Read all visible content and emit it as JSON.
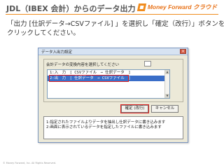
{
  "slide": {
    "title": "JDL（IBEX 会計）からのデータ出力",
    "logo_text": "Money Forward クラウド",
    "instruction_line1": "「出力 [仕訳データ→CSVファイル] 」を選択し「確定（改行）」ボタンを",
    "instruction_line2": "クリックしてください。",
    "copyright": "© Money Forward, Inc. All Rights Reserved."
  },
  "dialog": {
    "title": "データ入出力設定",
    "close_glyph": "×",
    "prompt": "会計データの変換内容を選択してください",
    "options": [
      {
        "label": "1:入　力　[ CSVファイル　→ 仕訳データ　]",
        "selected": false
      },
      {
        "label": "2:出　力　[ 仕訳データ　→ CSVファイル　]",
        "selected": true
      }
    ],
    "confirm_label": "確定 (改行)",
    "cancel_label": "キャンセル",
    "messages": [
      "1:指定されたファイルよりデータを抽出し仕訳データに書き込みます",
      "2:画面に表示されているデータを指定したファイルに書き込みます"
    ]
  },
  "colors": {
    "accent": "#f08c1e",
    "highlight": "#e02020",
    "selection": "#3a6ec8"
  }
}
